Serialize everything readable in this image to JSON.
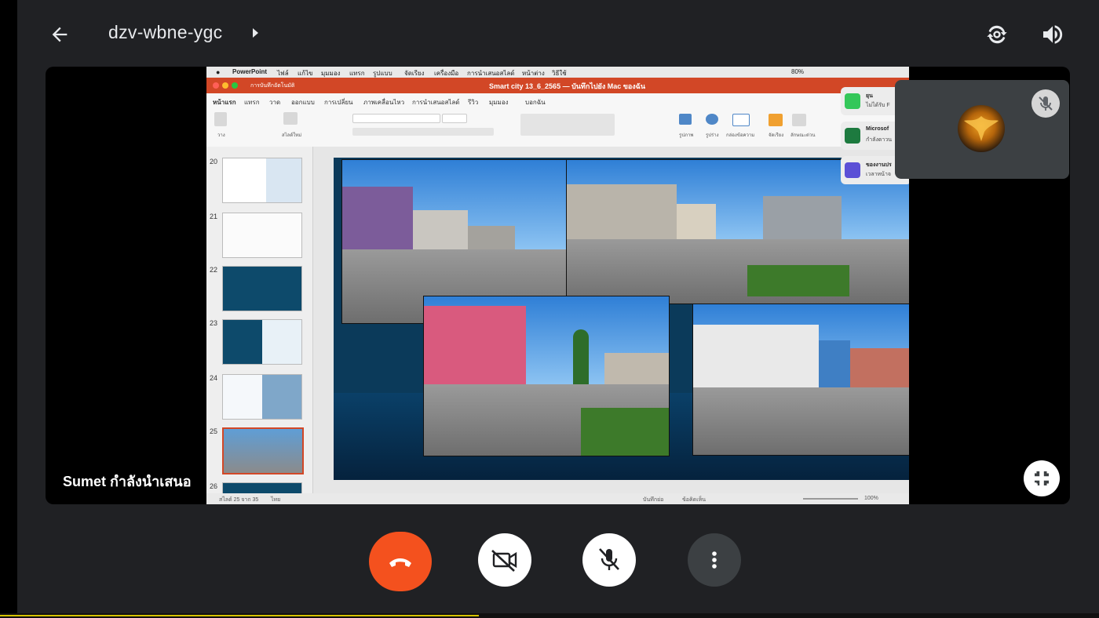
{
  "header": {
    "meeting_code": "dzv-wbne-ygc",
    "icons": [
      "back-arrow-icon",
      "switch-camera-icon",
      "speaker-icon"
    ]
  },
  "stage": {
    "presenter_label": "Sumet กำลังนำเสนอ"
  },
  "shared_screen": {
    "menubar": {
      "app": "PowerPoint",
      "items": [
        "ไฟล์",
        "แก้ไข",
        "มุมมอง",
        "แทรก",
        "รูปแบบ",
        "จัดเรียง",
        "เครื่องมือ",
        "การนำเสนอสไลด์",
        "หน้าต่าง",
        "วิธีใช้"
      ],
      "battery": "80%"
    },
    "window_title": "Smart city 13_6_2565 — บันทึกไปยัง Mac ของฉัน",
    "autosave_label": "การบันทึกอัตโนมัติ",
    "tabs": [
      "หน้าแรก",
      "แทรก",
      "วาด",
      "ออกแบบ",
      "การเปลี่ยน",
      "ภาพเคลื่อนไหว",
      "การนำเสนอสไลด์",
      "รีวิว",
      "มุมมอง",
      "บอกฉัน"
    ],
    "ribbon_labels": {
      "paste": "วาง",
      "new_slide": "สไลด์ใหม่",
      "picture": "รูปภาพ",
      "shape": "รูปร่าง",
      "textbox": "กล่องข้อความ",
      "arrange": "จัดเรียง",
      "quick_styles": "ลักษณะด่วน"
    },
    "thumbnails": [
      {
        "num": "20",
        "selected": false
      },
      {
        "num": "21",
        "selected": false
      },
      {
        "num": "22",
        "selected": false
      },
      {
        "num": "23",
        "selected": false
      },
      {
        "num": "24",
        "selected": false
      },
      {
        "num": "25",
        "selected": true
      },
      {
        "num": "26",
        "selected": false
      }
    ],
    "status": {
      "slide_counter": "สไลด์ 25 จาก 35",
      "language": "ไทย",
      "notes": "บันทึกย่อ",
      "comments": "ข้อคิดเห็น",
      "zoom": "100%"
    },
    "notifications": [
      {
        "title": "ยุน",
        "subtitle": "ไม่ได้รับ F",
        "color": "#34c759"
      },
      {
        "title": "Microsof",
        "subtitle": "กำลังดาวน",
        "color": "#1d7a3f"
      },
      {
        "title": "ของงานปร",
        "subtitle": "เวลาหน้าจ",
        "color": "#5b4fd6"
      }
    ]
  },
  "self_view": {
    "icons": [
      "avatar",
      "mic-muted-icon"
    ]
  },
  "controls": {
    "buttons": [
      "end-call-icon",
      "camera-off-icon",
      "mic-off-icon",
      "more-options-icon"
    ]
  },
  "colors": {
    "background": "#202124",
    "end_call": "#f4511e",
    "tile": "#3c4043",
    "powerpoint": "#d24726"
  }
}
